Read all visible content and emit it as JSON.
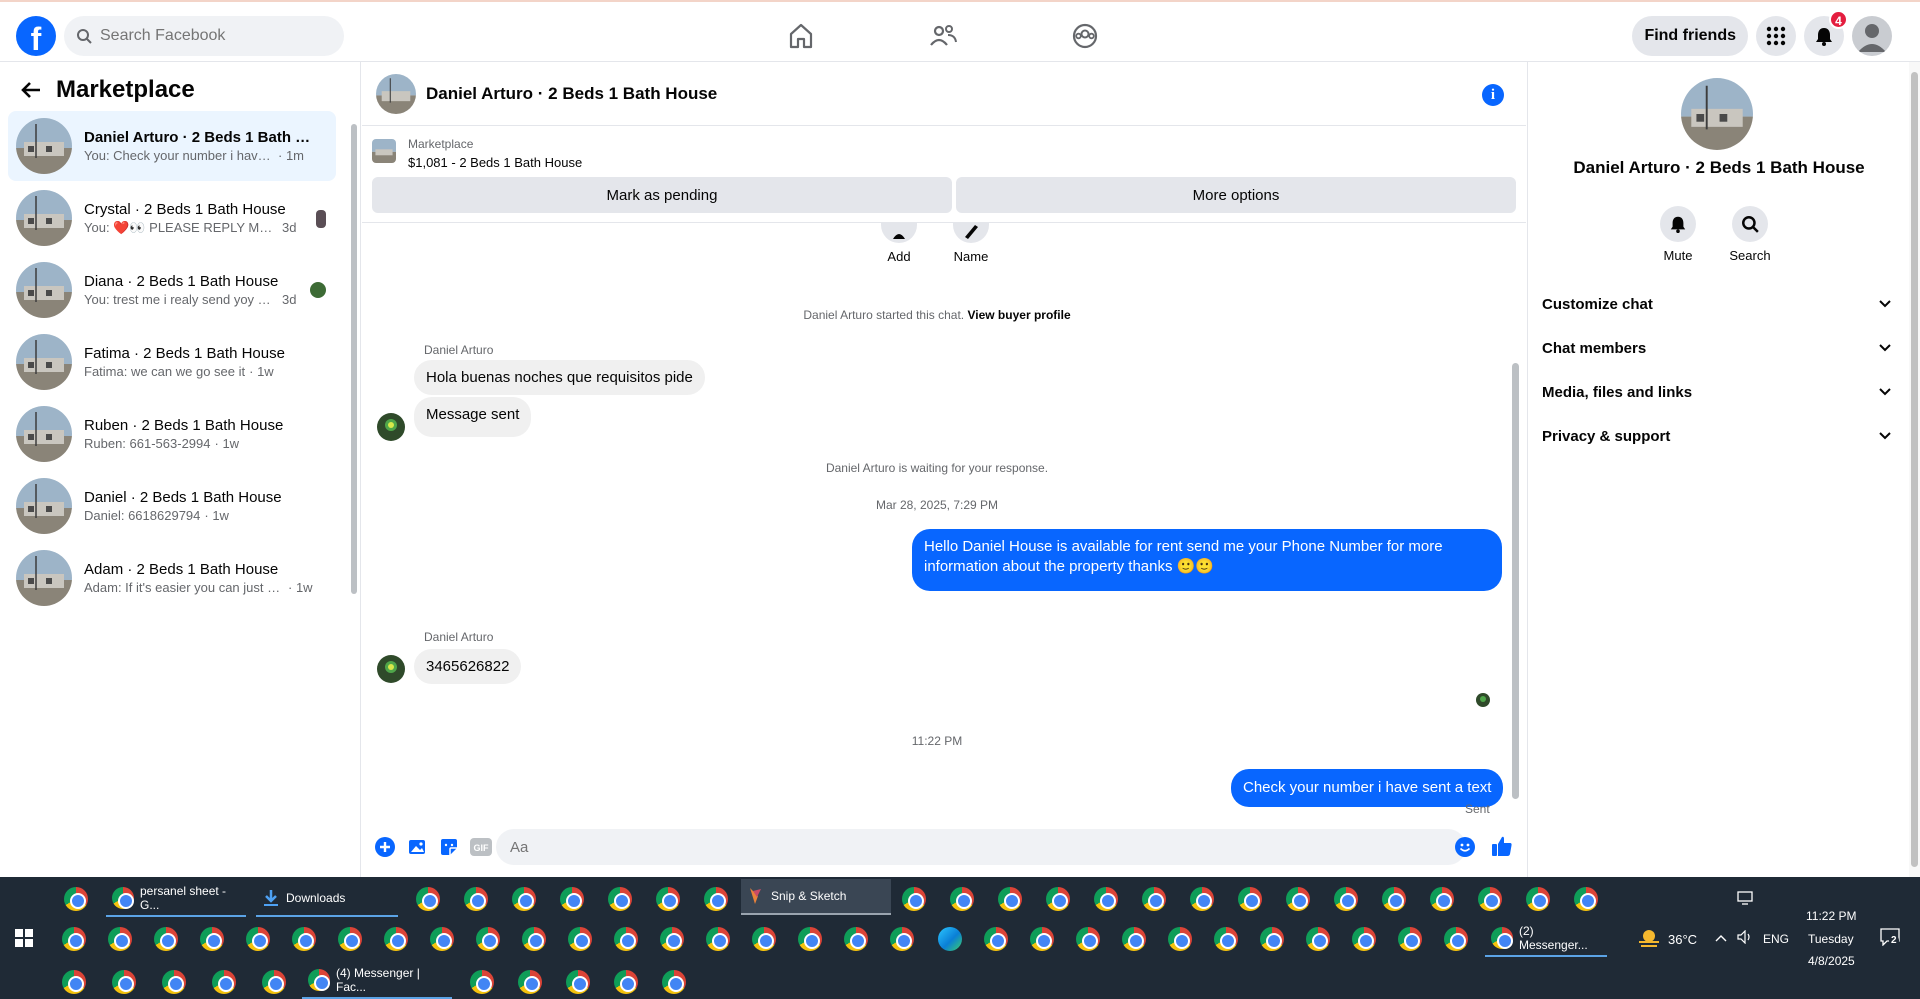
{
  "nav": {
    "search_placeholder": "Search Facebook",
    "find_friends": "Find friends",
    "notif_count": "4"
  },
  "left": {
    "title": "Marketplace",
    "conversations": [
      {
        "name": "Daniel Arturo · 2 Beds 1 Bath Ho...",
        "snippet": "You: Check your number i have se...",
        "time": "· 1m"
      },
      {
        "name": "Crystal · 2 Beds 1 Bath House",
        "snippet": "You: ❤️👀 PLEASE REPLY MUST ...",
        "time": "3d"
      },
      {
        "name": "Diana · 2 Beds 1 Bath House",
        "snippet": "You: trest me i realy send yoy pl...",
        "time": "3d"
      },
      {
        "name": "Fatima · 2 Beds 1 Bath House",
        "snippet": "Fatima: we can we go see it",
        "time": "· 1w"
      },
      {
        "name": "Ruben · 2 Beds 1 Bath House",
        "snippet": "Ruben: 661-563-2994",
        "time": "· 1w"
      },
      {
        "name": "Daniel · 2 Beds 1 Bath House",
        "snippet": "Daniel: 6618629794",
        "time": "· 1w"
      },
      {
        "name": "Adam · 2 Beds 1 Bath House",
        "snippet": "Adam: If it's easier you can just call...",
        "time": "· 1w"
      }
    ]
  },
  "chat": {
    "title": "Daniel Arturo · 2 Beds 1 Bath House",
    "listing_source": "Marketplace",
    "listing_price": "$1,081 - 2 Beds 1 Bath House",
    "mark_pending": "Mark as pending",
    "more_options": "More options",
    "quick_add": "Add",
    "quick_name": "Name",
    "started_text": "Daniel Arturo started this chat.",
    "view_profile": "View buyer profile",
    "sender_1": "Daniel Arturo",
    "msg_1": "Hola buenas noches que requisitos pide",
    "msg_2": "Message sent",
    "waiting": "Daniel Arturo is waiting for your response.",
    "timestamp_1": "Mar 28, 2025, 7:29 PM",
    "msg_out_1": "Hello Daniel House is available for rent send me your Phone Number for more information about the property thanks 🙂🙂",
    "sender_2": "Daniel Arturo",
    "msg_3": "3465626822",
    "timestamp_2": "11:22 PM",
    "msg_out_2": "Check your number i have sent a text",
    "sent_status": "Sent",
    "input_placeholder": "Aa"
  },
  "right": {
    "name": "Daniel Arturo · 2 Beds 1 Bath House",
    "mute": "Mute",
    "search": "Search",
    "sections": [
      "Customize chat",
      "Chat members",
      "Media, files and links",
      "Privacy & support"
    ]
  },
  "taskbar": {
    "app_sheet": "persanel sheet - G...",
    "app_downloads": "Downloads",
    "app_snip": "Snip & Sketch",
    "app_messenger2": "(2) Messenger...",
    "app_messenger4": "(4) Messenger | Fac...",
    "weather": "36°C",
    "lang": "ENG",
    "time": "11:22 PM",
    "day": "Tuesday",
    "date": "4/8/2025",
    "notif": "2"
  }
}
